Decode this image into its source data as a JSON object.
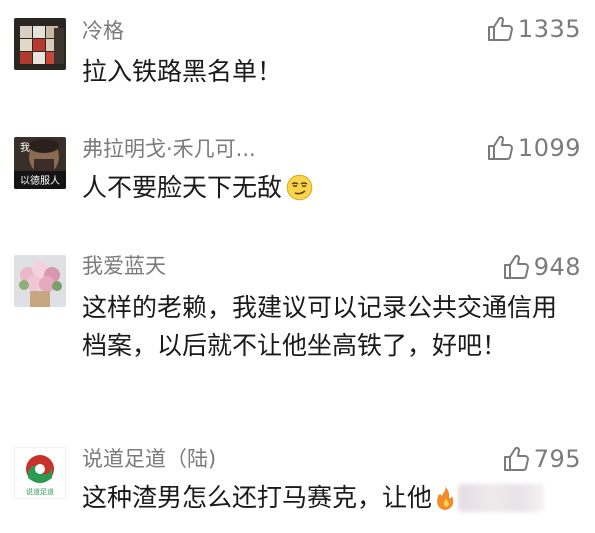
{
  "comments": [
    {
      "username": "冷格",
      "likes": "1335",
      "text": "拉入铁路黑名单！",
      "avatar": "rubiks-cube"
    },
    {
      "username": "弗拉明戈·禾几可...",
      "likes": "1099",
      "text": "人不要脸天下无敌",
      "avatar": "man-meme",
      "avatar_caption": "以德服人",
      "avatar_tag": "我"
    },
    {
      "username": "我爱蓝天",
      "likes": "948",
      "text": "这样的老赖，我建议可以记录公共交通信用档案，以后就不让他坐高铁了，好吧！",
      "avatar": "flower-bouquet"
    },
    {
      "username": "说道足道（陆)",
      "likes": "795",
      "text": "这种渣男怎么还打马赛克，让他",
      "avatar": "logo",
      "avatar_caption": "说道足道"
    }
  ],
  "colors": {
    "username": "#7b7b7b",
    "text": "#1a1a1a",
    "like": "#7b7b7b",
    "background": "#ffffff"
  },
  "icons": {
    "like": "thumbs-up-icon",
    "emoji": "smirk-emoji-icon",
    "fire": "fire-icon"
  }
}
